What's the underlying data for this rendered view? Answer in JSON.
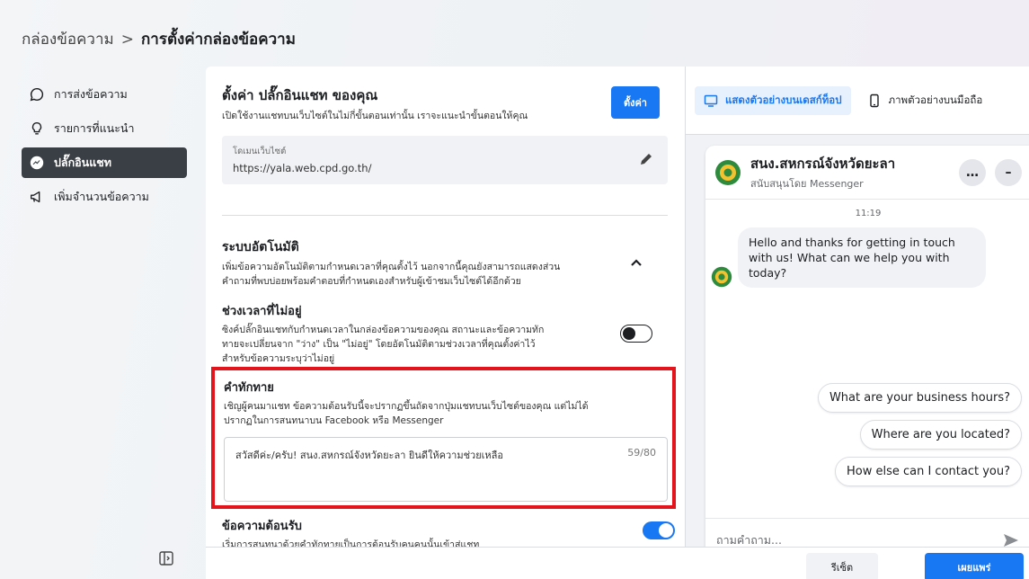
{
  "breadcrumb": {
    "parent": "กล่องข้อความ",
    "separator": ">",
    "current": "การตั้งค่ากล่องข้อความ"
  },
  "sidebar": {
    "items": [
      {
        "label": "การส่งข้อความ",
        "icon": "chat-icon",
        "active": false
      },
      {
        "label": "รายการที่แนะนำ",
        "icon": "lightbulb-icon",
        "active": false
      },
      {
        "label": "ปลั๊กอินแชท",
        "icon": "messenger-icon",
        "active": true
      },
      {
        "label": "เพิ่มจำนวนข้อความ",
        "icon": "megaphone-icon",
        "active": false
      }
    ]
  },
  "plugin": {
    "title": "ตั้งค่า ปลั๊กอินแชท ของคุณ",
    "desc": "เปิดใช้งานแชทบนเว็บไซต์ในไม่กี่ขั้นตอนเท่านั้น เราจะแนะนำขั้นตอนให้คุณ",
    "setup_button": "ตั้งค่า",
    "domain_label": "โดเมนเว็บไซต์",
    "domain_value": "https://yala.web.cpd.go.th/"
  },
  "automation": {
    "title": "ระบบอัตโนมัติ",
    "desc1": "เพิ่มข้อความอัตโนมัติตามกำหนดเวลาที่คุณตั้งไว้ นอกจากนี้คุณยังสามารถแสดงส่วน",
    "desc2": "คำถามที่พบบ่อยพร้อมคำตอบที่กำหนดเองสำหรับผู้เข้าชมเว็บไซต์ได้อีกด้วย",
    "away_title": "ช่วงเวลาที่ไม่อยู่",
    "away_desc1": "ซิงค์ปลั๊กอินแชทกับกำหนดเวลาในกล่องข้อความของคุณ สถานะและข้อความทัก",
    "away_desc2": "ทายจะเปลี่ยนจาก \"ว่าง\" เป็น \"ไม่อยู่\" โดยอัตโนมัติตามช่วงเวลาที่คุณตั้งค่าไว้",
    "away_desc3": "สำหรับข้อความระบุว่าไม่อยู่",
    "away_toggle_on": false
  },
  "greeting": {
    "title": "คำทักทาย",
    "desc1": "เชิญผู้คนมาแชท ข้อความต้อนรับนี้จะปรากฏขึ้นถัดจากปุ่มแชทบนเว็บไซต์ของคุณ แต่ไม่ได้",
    "desc2": "ปรากฏในการสนทนาบน Facebook หรือ Messenger",
    "value": "สวัสดีค่ะ/ครับ! สนง.สหกรณ์จังหวัดยะลา ยินดีให้ความช่วยเหลือ",
    "count": "59/80"
  },
  "welcome": {
    "title": "ข้อความต้อนรับ",
    "desc": "เริ่มการสนทนาด้วยคำทักทายเป็นการต้อนรับคนคนนั้นเข้าสู่แชท",
    "toggle_on": true
  },
  "preview": {
    "tab_desktop": "แสดงตัวอย่างบนเดสก์ท็อป",
    "tab_mobile": "ภาพตัวอย่างบนมือถือ",
    "page_name": "สนง.สหกรณ์จังหวัดยะลา",
    "supported_by": "สนับสนุนโดย Messenger",
    "time": "11:19",
    "message": "Hello and thanks for getting in touch with us! What can we help you with today?",
    "quick_replies": [
      "What are your business hours?",
      "Where are you located?",
      "How else can I contact you?"
    ],
    "input_placeholder": "ถามคำถาม..."
  },
  "footer": {
    "reset": "รีเซ็ต",
    "publish": "เผยแพร่"
  },
  "colors": {
    "accent": "#1877f2",
    "highlight": "#e3141b",
    "active_nav": "#3a3f45"
  }
}
